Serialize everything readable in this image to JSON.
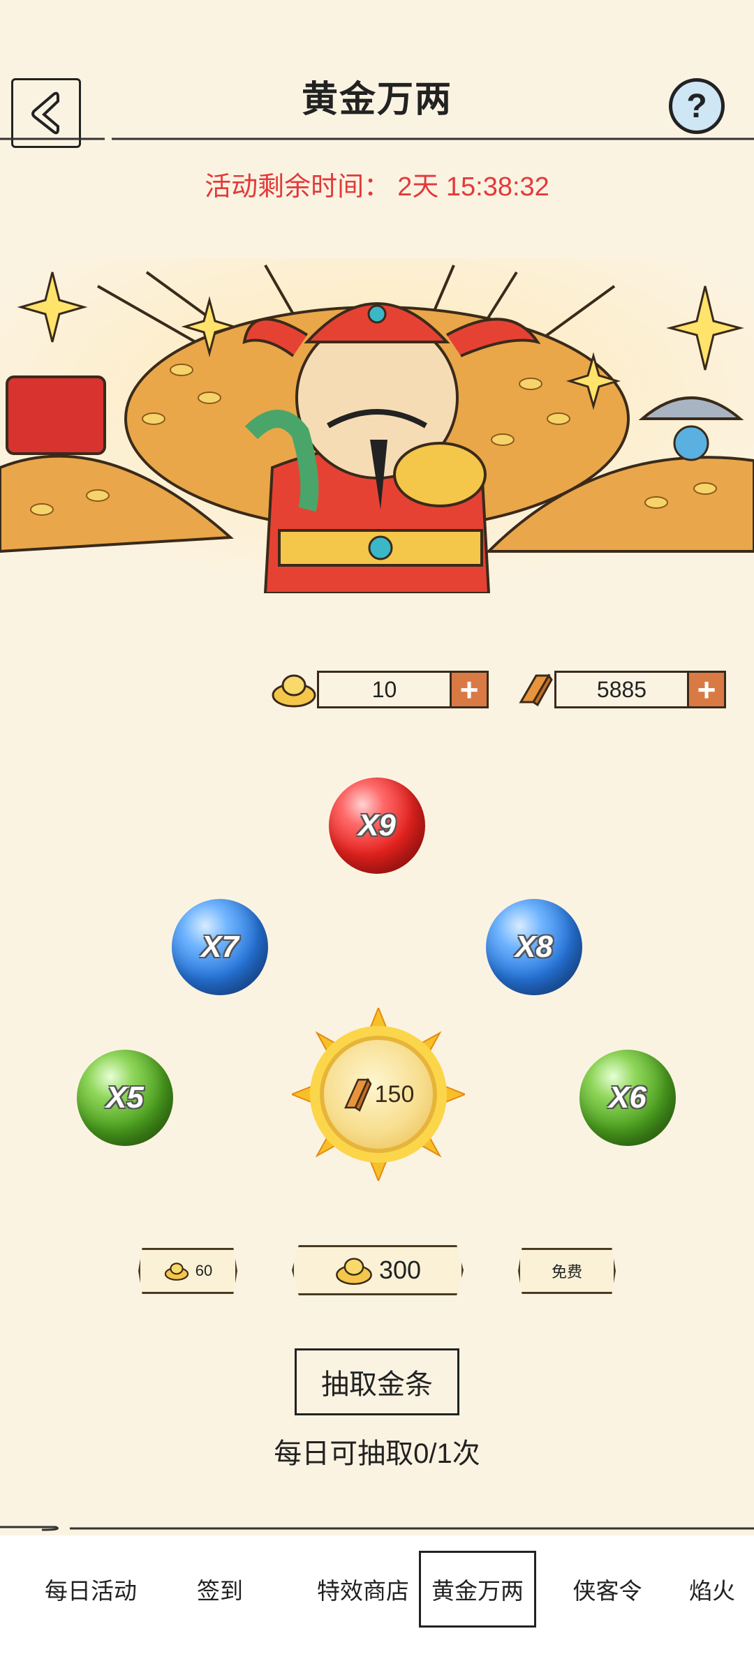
{
  "header": {
    "title": "黄金万两",
    "help_label": "?"
  },
  "timer": {
    "label": "活动剩余时间：",
    "value": "2天 15:38:32"
  },
  "currencies": [
    {
      "icon": "gold-ingot-icon",
      "value": "10"
    },
    {
      "icon": "gold-bar-icon",
      "value": "5885"
    }
  ],
  "multipliers": {
    "x9": "X9",
    "x7": "X7",
    "x8": "X8",
    "x5": "X5",
    "x6": "X6"
  },
  "center_reward": {
    "value": "150"
  },
  "options": {
    "opt_60": "60",
    "opt_300": "300",
    "opt_free": "免费"
  },
  "draw_button": "抽取金条",
  "daily_limit": "每日可抽取0/1次",
  "tabs": [
    "每日活动",
    "签到",
    "特效商店",
    "黄金万两",
    "侠客令",
    "焰火"
  ],
  "colors": {
    "timer": "#e23a3a",
    "background": "#fbf3e2"
  }
}
